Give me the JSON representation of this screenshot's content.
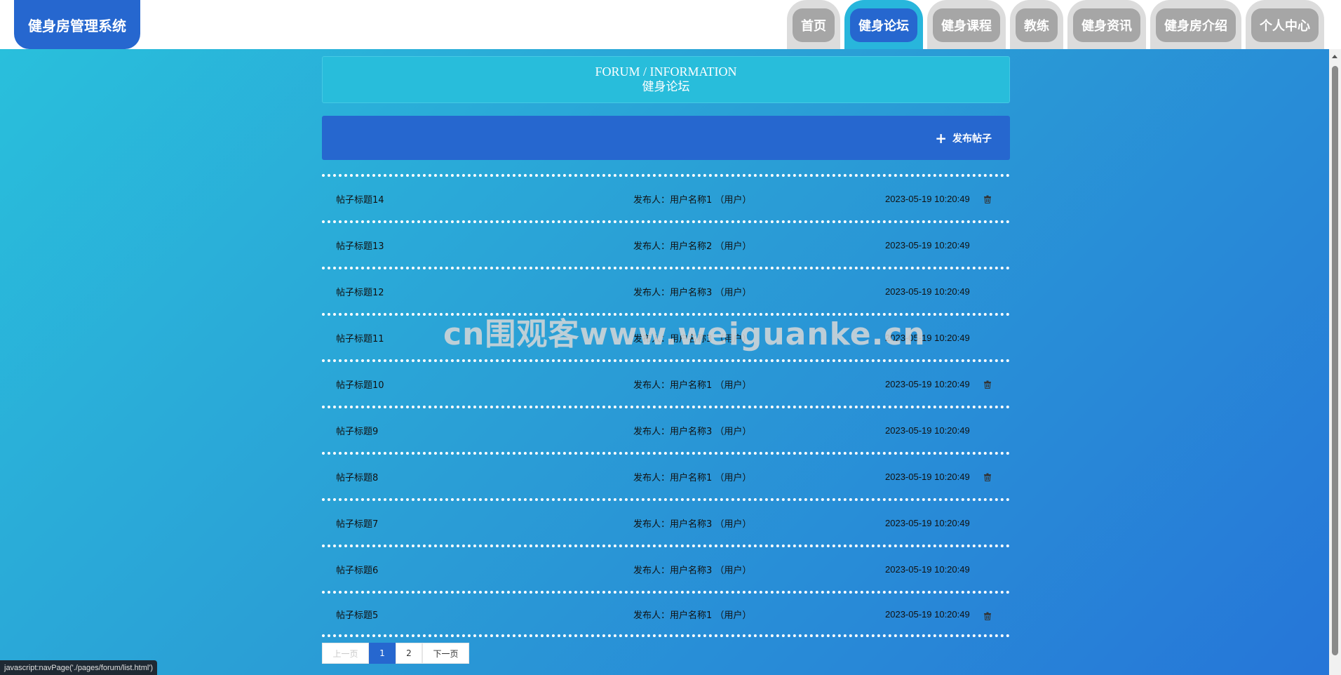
{
  "header": {
    "logo": "健身房管理系统",
    "nav": [
      {
        "label": "首页",
        "active": false
      },
      {
        "label": "健身论坛",
        "active": true
      },
      {
        "label": "健身课程",
        "active": false
      },
      {
        "label": "教练",
        "active": false
      },
      {
        "label": "健身资讯",
        "active": false
      },
      {
        "label": "健身房介绍",
        "active": false
      },
      {
        "label": "个人中心",
        "active": false
      }
    ]
  },
  "section": {
    "title_en": "FORUM / INFORMATION",
    "title_cn": "健身论坛"
  },
  "actions": {
    "post_label": "发布帖子",
    "post_icon": "plus-icon"
  },
  "posts": [
    {
      "title": "帖子标题14",
      "author": "发布人：用户名称1 （用户）",
      "time": "2023-05-19 10:20:49",
      "deletable": true
    },
    {
      "title": "帖子标题13",
      "author": "发布人：用户名称2 （用户）",
      "time": "2023-05-19 10:20:49",
      "deletable": false
    },
    {
      "title": "帖子标题12",
      "author": "发布人：用户名称3 （用户）",
      "time": "2023-05-19 10:20:49",
      "deletable": false
    },
    {
      "title": "帖子标题11",
      "author": "发布人：用户名称3 （用户）",
      "time": "2023-05-19 10:20:49",
      "deletable": false
    },
    {
      "title": "帖子标题10",
      "author": "发布人：用户名称1 （用户）",
      "time": "2023-05-19 10:20:49",
      "deletable": true
    },
    {
      "title": "帖子标题9",
      "author": "发布人：用户名称3 （用户）",
      "time": "2023-05-19 10:20:49",
      "deletable": false
    },
    {
      "title": "帖子标题8",
      "author": "发布人：用户名称1 （用户）",
      "time": "2023-05-19 10:20:49",
      "deletable": true
    },
    {
      "title": "帖子标题7",
      "author": "发布人：用户名称3 （用户）",
      "time": "2023-05-19 10:20:49",
      "deletable": false
    },
    {
      "title": "帖子标题6",
      "author": "发布人：用户名称3 （用户）",
      "time": "2023-05-19 10:20:49",
      "deletable": false
    },
    {
      "title": "帖子标题5",
      "author": "发布人：用户名称1 （用户）",
      "time": "2023-05-19 10:20:49",
      "deletable": true
    }
  ],
  "pagination": {
    "prev": "上一页",
    "pages": [
      "1",
      "2"
    ],
    "current": "1",
    "next": "下一页"
  },
  "watermark": "cn围观客www.weiguanke.cn",
  "status_bar": "javascript:navPage('./pages/forum/list.html')",
  "colors": {
    "primary": "#2667cf",
    "accent": "#28bddb",
    "tab_inactive": "#a6a6a6"
  }
}
